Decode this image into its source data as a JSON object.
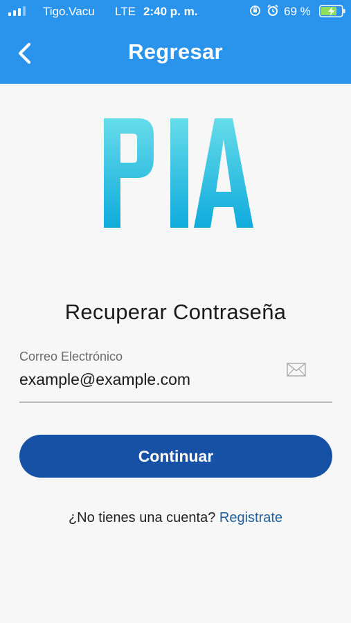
{
  "status_bar": {
    "carrier": "Tigo.Vacu",
    "network": "LTE",
    "time": "2:40 p. m.",
    "battery": "69 %"
  },
  "header": {
    "title": "Regresar"
  },
  "logo": {
    "text": "PIA"
  },
  "form": {
    "heading": "Recuperar Contraseña",
    "email_label": "Correo Electrónico",
    "email_value": "example@example.com",
    "continue_label": "Continuar"
  },
  "footer": {
    "prompt": "¿No tienes una cuenta?",
    "link": "Registrate"
  },
  "colors": {
    "header": "#2a94ec",
    "button": "#1651a6",
    "link": "#1f5f9e",
    "logo_gradient_top": "#66dcea",
    "logo_gradient_bottom": "#0fabdc"
  }
}
